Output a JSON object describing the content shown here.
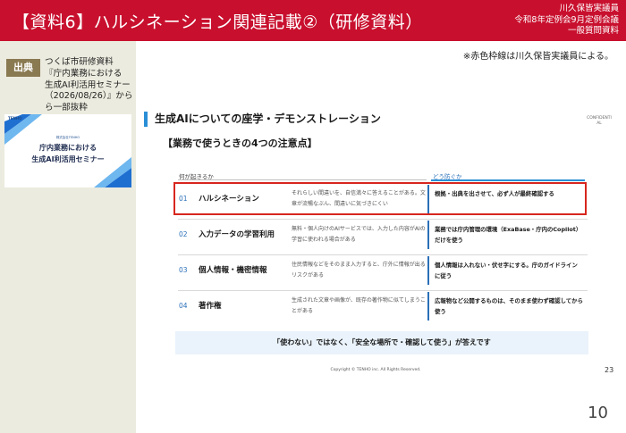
{
  "header": {
    "title": "【資料6】ハルシネーション関連記載②（研修資料）",
    "right_lines": [
      "川久保皆実議員",
      "令和8年定例会9月定例会議",
      "一般質問資料"
    ]
  },
  "source": {
    "badge": "出典",
    "lines": [
      "つくば市研修資料",
      "『庁内業務における",
      "生成AI利活用セミナー",
      "（2026/08/26）』から",
      "ら一部抜粋"
    ]
  },
  "thumbnail": {
    "logo": "TENHO",
    "small_text": "株式会社TENHO",
    "title_lines": [
      "庁内業務における",
      "生成AI利活用セミナー"
    ]
  },
  "note": "※赤色枠線は川久保皆実議員による。",
  "slide": {
    "title": "生成AIについての座学・デモンストレーション",
    "confidential": "CONFIDENTIAL",
    "heading": "【業務で使うときの4つの注意点】",
    "col_left": "何が起きるか",
    "col_right": "どう防ぐか",
    "rows": [
      {
        "num": "01",
        "name": "ハルシネーション",
        "desc": "それらしい間違いを、自信満々に答えることがある。文章が流暢なぶん、間違いに気づきにくい",
        "action": "根拠・出典を出させて、必ず人が最終確認する"
      },
      {
        "num": "02",
        "name": "入力データの学習利用",
        "desc": "無料・個人向けのAIサービスでは、入力した内容がAIの学習に使われる場合がある",
        "action": "業務では庁内管理の環境（ExaBase・庁内のCopilot）だけを使う"
      },
      {
        "num": "03",
        "name": "個人情報・機密情報",
        "desc": "住民情報などをそのまま入力すると、庁外に情報が出るリスクがある",
        "action": "個人情報は入れない・伏せ字にする。庁のガイドラインに従う"
      },
      {
        "num": "04",
        "name": "著作権",
        "desc": "生成された文章や画像が、既存の著作物に似てしまうことがある",
        "action": "広報物など公開するものは、そのまま使わず確認してから使う"
      }
    ],
    "summary": "「使わない」ではなく、「安全な場所で・確認して使う」が答えです",
    "copyright": "Copyright © TENHO inc. All Rights Reserved.",
    "slide_number": "23"
  },
  "page_number": "10",
  "colors": {
    "header_bg": "#c8102e",
    "sidebar_bg": "#ecebdf",
    "badge_bg": "#8a7a52",
    "accent_blue": "#2a8fd6",
    "highlight_red": "#d7261e",
    "summary_bg": "#eaf3fb"
  }
}
